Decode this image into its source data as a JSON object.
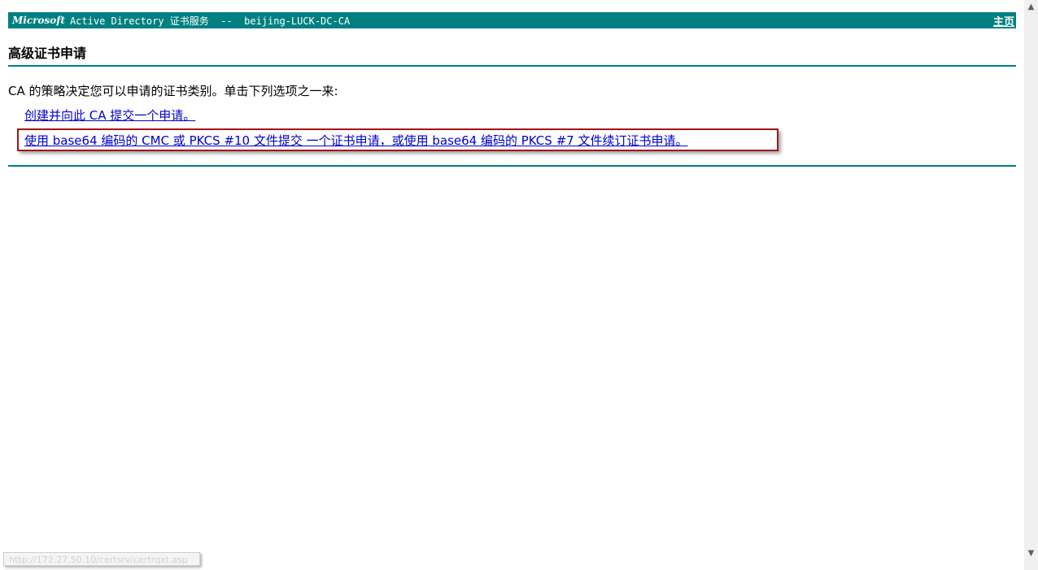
{
  "header": {
    "brand": "Microsoft",
    "title": "Active Directory 证书服务  --  beijing-LUCK-DC-CA",
    "home_label": "主页"
  },
  "page": {
    "title": "高级证书申请",
    "intro": "CA 的策略决定您可以申请的证书类别。单击下列选项之一来:"
  },
  "options": [
    {
      "label": "创建并向此 CA 提交一个申请。"
    },
    {
      "label": "使用 base64 编码的 CMC 或 PKCS #10 文件提交 一个证书申请，或使用 base64 编码的 PKCS #7 文件续订证书申请。"
    }
  ],
  "status_bar": {
    "url": "http://172.27.50.10/certsrv/certrqxt.asp"
  },
  "colors": {
    "accent": "#008080",
    "link": "#0000cc",
    "highlight": "#a31515"
  }
}
